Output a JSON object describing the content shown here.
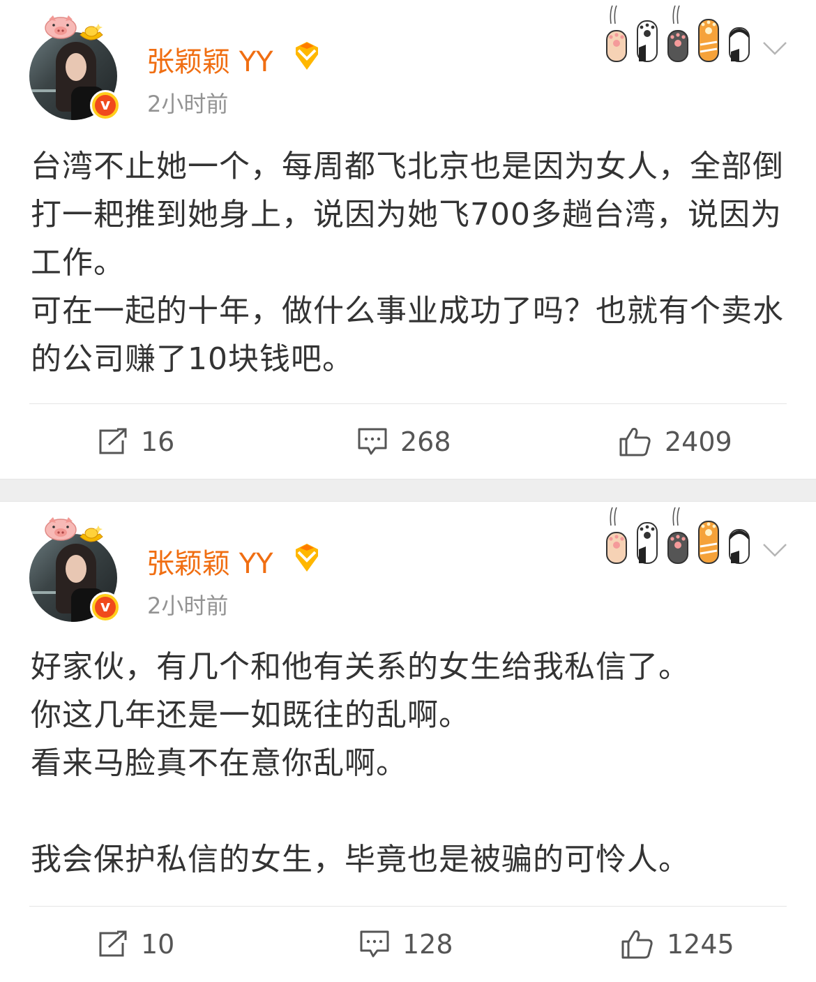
{
  "posts": [
    {
      "username": "张颖颖 YY",
      "time": "2小时前",
      "paragraphs": [
        "台湾不止她一个，每周都飞北京也是因为女人，全部倒打一耙推到她身上，说因为她飞700多趟台湾，说因为工作。",
        "可在一起的十年，做什么事业成功了吗？也就有个卖水的公司赚了10块钱吧。"
      ],
      "repost_count": "16",
      "comment_count": "268",
      "like_count": "2409"
    },
    {
      "username": "张颖颖 YY",
      "time": "2小时前",
      "paragraphs": [
        "好家伙，有几个和他有关系的女生给我私信了。",
        "你这几年还是一如既往的乱啊。",
        "看来马脸真不在意你乱啊。",
        "",
        "我会保护私信的女生，毕竟也是被骗的可怜人。"
      ],
      "repost_count": "10",
      "comment_count": "128",
      "like_count": "1245"
    }
  ],
  "colors": {
    "username": "#f06e12",
    "time": "#939393",
    "verified_badge": "#f04a1c",
    "separator": "#eeeeee"
  },
  "icons": {
    "avatar_decoration": [
      "pig-icon",
      "gold-ingot-icon"
    ],
    "verified": "verified-v-icon",
    "rank": "rank-badge-icon",
    "sticker": "cat-paws-sticker",
    "menu": "chevron-down-icon",
    "repost": "repost-icon",
    "comment": "comment-icon",
    "like": "like-icon"
  }
}
